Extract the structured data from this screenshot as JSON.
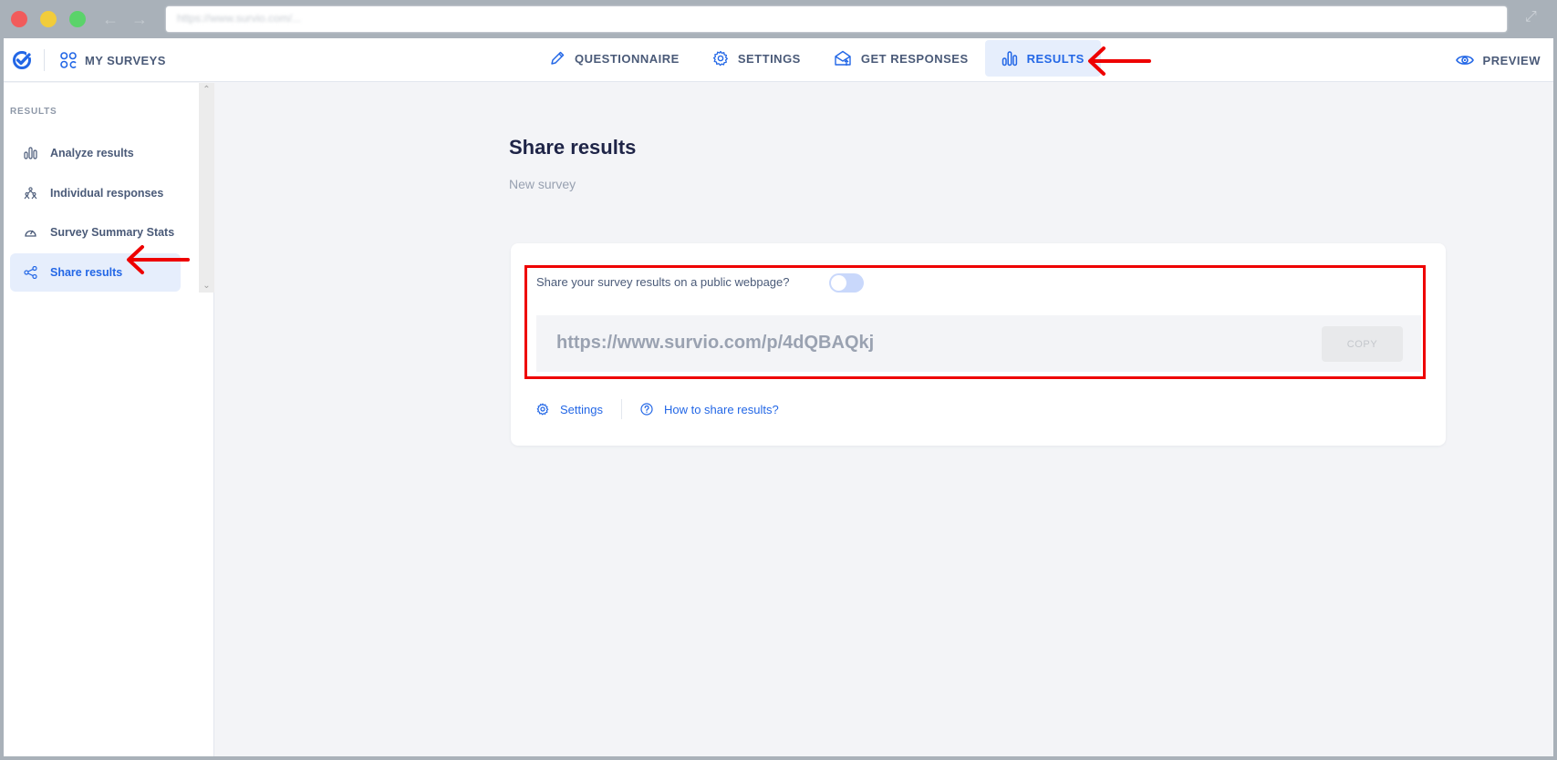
{
  "browser": {
    "address": "https://www.survio.com/..."
  },
  "header": {
    "my_surveys": "MY SURVEYS",
    "tabs": [
      {
        "label": "QUESTIONNAIRE",
        "icon": "pencil-icon"
      },
      {
        "label": "SETTINGS",
        "icon": "gear-icon"
      },
      {
        "label": "GET RESPONSES",
        "icon": "envelope-upload-icon"
      },
      {
        "label": "RESULTS",
        "icon": "bar-chart-icon",
        "active": true
      }
    ],
    "preview": "PREVIEW"
  },
  "sidebar": {
    "heading": "RESULTS",
    "items": [
      {
        "label": "Analyze results",
        "icon": "bar-chart-icon"
      },
      {
        "label": "Individual responses",
        "icon": "people-icon"
      },
      {
        "label": "Survey Summary Stats",
        "icon": "gauge-icon"
      },
      {
        "label": "Share results",
        "icon": "share-icon",
        "active": true
      }
    ]
  },
  "main": {
    "title": "Share results",
    "subtitle": "New survey",
    "share_question": "Share your survey results on a public webpage?",
    "toggle_on": false,
    "share_url": "https://www.survio.com/p/4dQBAQkj",
    "copy_label": "COPY",
    "links": [
      {
        "label": "Settings",
        "icon": "gear-icon"
      },
      {
        "label": "How to share results?",
        "icon": "help-circle-icon"
      }
    ]
  },
  "colors": {
    "accent": "#2367e6",
    "active_bg": "#e6eefc",
    "annotation": "#ee0000",
    "text": "#4a5a78",
    "title": "#1e2447"
  }
}
